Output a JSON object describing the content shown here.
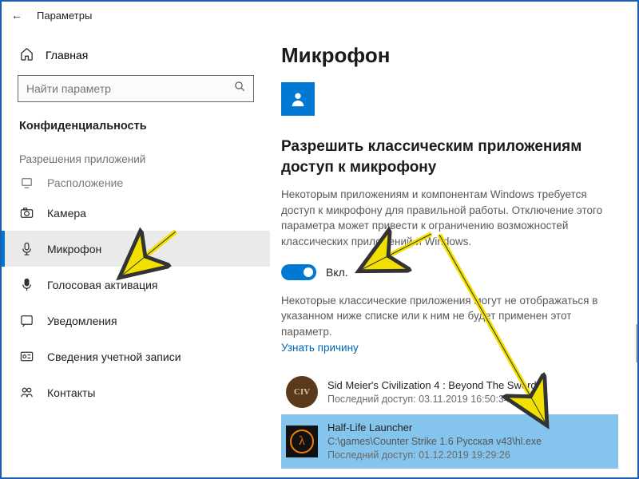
{
  "titlebar": {
    "title": "Параметры"
  },
  "sidebar": {
    "home": "Главная",
    "search_placeholder": "Найти параметр",
    "section": "Конфиденциальность",
    "subhead": "Разрешения приложений",
    "items": [
      {
        "label": "Расположение"
      },
      {
        "label": "Камера"
      },
      {
        "label": "Микрофон"
      },
      {
        "label": "Голосовая активация"
      },
      {
        "label": "Уведомления"
      },
      {
        "label": "Сведения учетной записи"
      },
      {
        "label": "Контакты"
      }
    ]
  },
  "content": {
    "page_title": "Микрофон",
    "section_heading": "Разрешить классическим приложениям доступ к микрофону",
    "description": "Некоторым приложениям и компонентам Windows требуется доступ к микрофону для правильной работы. Отключение этого параметра может привести к ограничению возможностей классических приложений и Windows.",
    "toggle_label": "Вкл.",
    "note": "Некоторые классические приложения могут не отображаться в указанном ниже списке или к ним не будет применен этот параметр.",
    "link": "Узнать причину",
    "apps": [
      {
        "name": "Sid Meier's Civilization 4 : Beyond The Sword",
        "time": "Последний доступ: 03.11.2019 16:50:34"
      },
      {
        "name": "Half-Life Launcher",
        "path": "C:\\games\\Counter Strike 1.6 Русская v43\\hl.exe",
        "time": "Последний доступ: 01.12.2019 19:29:26"
      }
    ]
  }
}
